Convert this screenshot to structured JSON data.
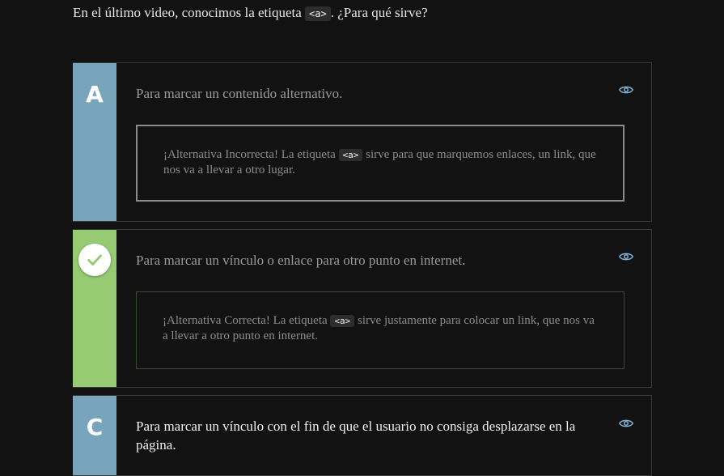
{
  "question": {
    "before": "En el último video, conocimos la etiqueta",
    "code": "<a>",
    "after": ". ¿Para qué sirve?"
  },
  "options": [
    {
      "letter": "A",
      "text": "Para marcar un contenido alternativo.",
      "feedback": {
        "before": "¡Alternativa Incorrecta! La etiqueta",
        "code": "<a>",
        "after": "sirve para que marquemos enlaces, un link, que nos va a llevar a otro lugar."
      }
    },
    {
      "letter": "",
      "text": "Para marcar un vínculo o enlace para otro punto en internet.",
      "feedback": {
        "before": "¡Alternativa Correcta! La etiqueta",
        "code": "<a>",
        "after": "sirve justamente para colocar un link, que nos va a llevar a otro punto en internet."
      }
    },
    {
      "letter": "C",
      "text": "Para marcar un vínculo con el fin de que el usuario no consiga desplazarse en la página."
    }
  ],
  "icons": {
    "reveal": "eye-icon",
    "correct": "checkmark-icon"
  },
  "colors": {
    "background": "#121212",
    "option_side_blue": "#79a5bc",
    "option_side_green": "#97cb73",
    "eye_icon": "#7fb2d6"
  }
}
